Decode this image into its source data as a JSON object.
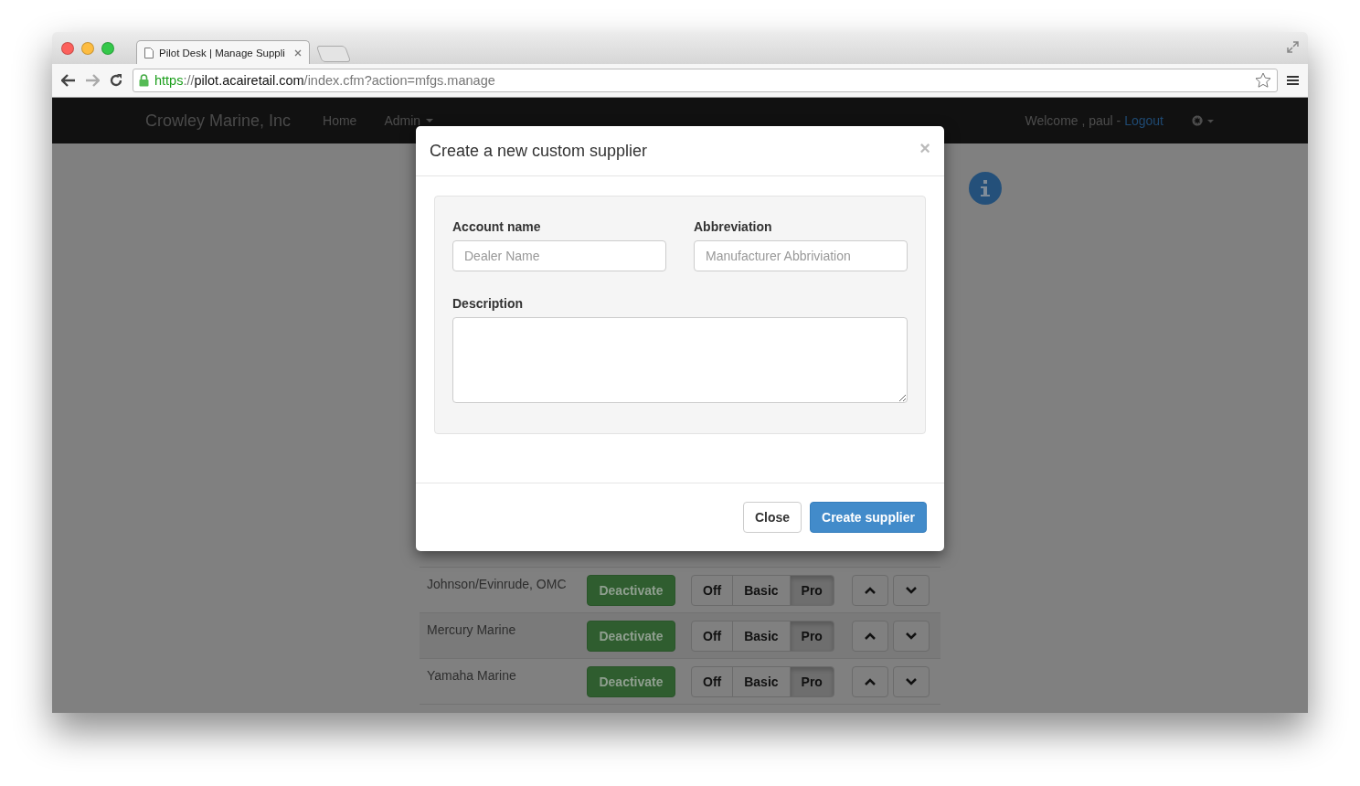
{
  "browser": {
    "tab_title": "Pilot Desk | Manage Suppli",
    "url_scheme": "https",
    "url_sep": "://",
    "url_host": "pilot.acairetail.com",
    "url_path": "/index.cfm?action=mfgs.manage"
  },
  "navbar": {
    "brand": "Crowley Marine, Inc",
    "links": [
      {
        "label": "Home",
        "dropdown": false
      },
      {
        "label": "Admin",
        "dropdown": true
      }
    ],
    "welcome": "Welcome , paul - ",
    "logout": "Logout"
  },
  "modal": {
    "title": "Create a new custom supplier",
    "close_glyph": "×",
    "fields": [
      {
        "label": "Account name",
        "placeholder": "Dealer Name"
      },
      {
        "label": "Abbreviation",
        "placeholder": "Manufacturer Abbriviation"
      }
    ],
    "description_label": "Description",
    "buttons": [
      {
        "label": "Close",
        "kind": "default"
      },
      {
        "label": "Create supplier",
        "kind": "primary"
      }
    ]
  },
  "rows": [
    {
      "name": "Johnson/Evinrude, OMC",
      "action": "Deactivate",
      "levels": [
        {
          "label": "Off",
          "selected": false
        },
        {
          "label": "Basic",
          "selected": false
        },
        {
          "label": "Pro",
          "selected": true
        }
      ]
    },
    {
      "name": "Mercury Marine",
      "action": "Deactivate",
      "levels": [
        {
          "label": "Off",
          "selected": false
        },
        {
          "label": "Basic",
          "selected": false
        },
        {
          "label": "Pro",
          "selected": true
        }
      ]
    },
    {
      "name": "Yamaha Marine",
      "action": "Deactivate",
      "levels": [
        {
          "label": "Off",
          "selected": false
        },
        {
          "label": "Basic",
          "selected": false
        },
        {
          "label": "Pro",
          "selected": true
        }
      ]
    }
  ]
}
